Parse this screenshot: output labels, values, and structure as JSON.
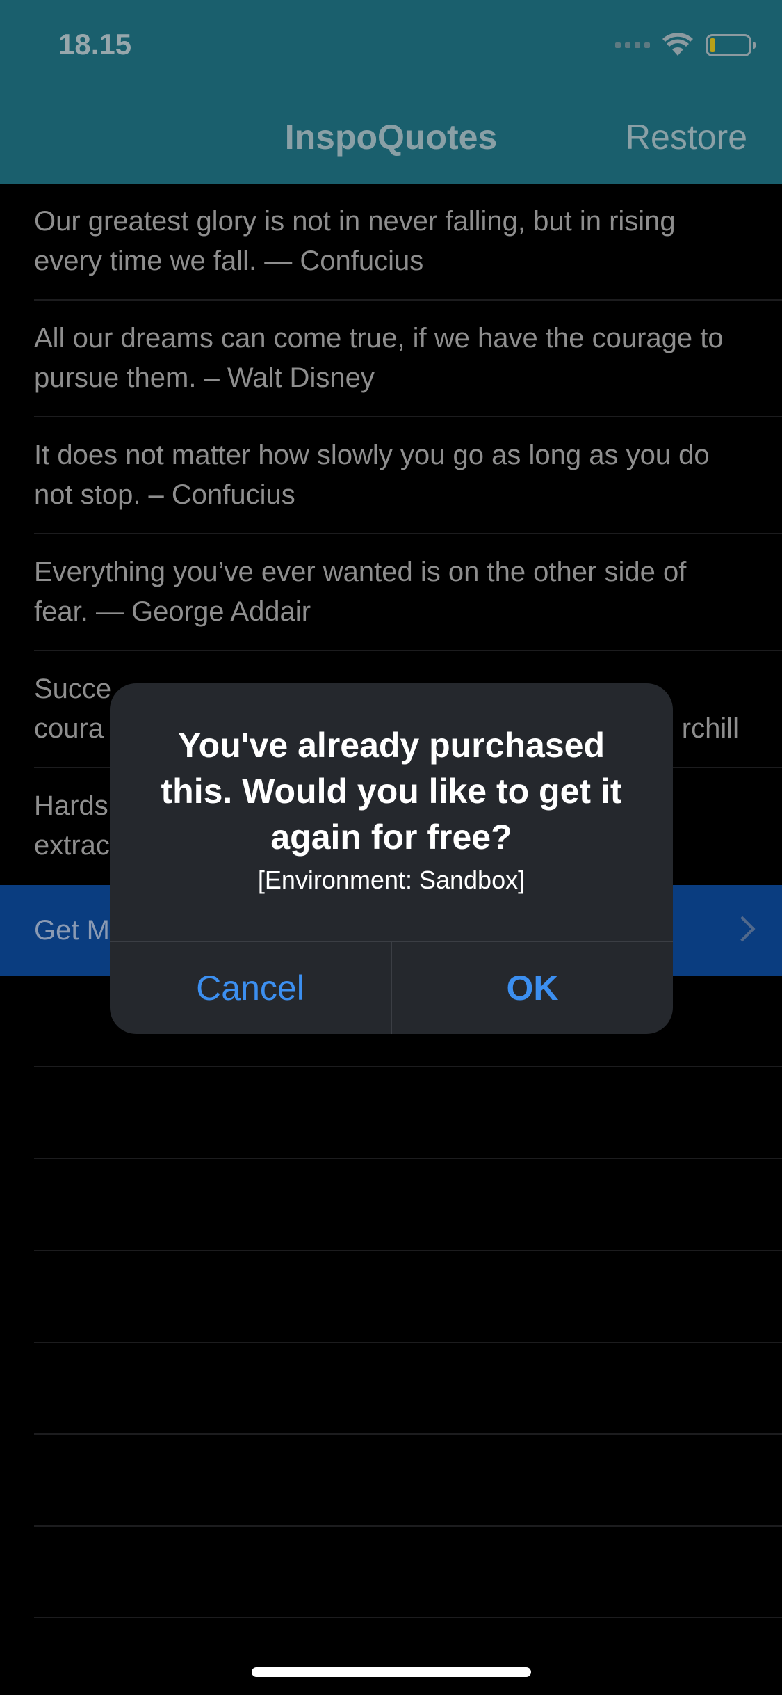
{
  "status_bar": {
    "time": "18.15",
    "battery_level": 0.15,
    "battery_color": "#b9a019"
  },
  "nav": {
    "title": "InspoQuotes",
    "restore_label": "Restore",
    "background": "#1a5f6d"
  },
  "quotes": [
    {
      "text": "Our greatest glory is not in never falling, but in rising every time we fall. — Confucius"
    },
    {
      "text": "All our dreams can come true, if we have the courage to pursue them. – Walt Disney"
    },
    {
      "text": "It does not matter how slowly you go as long as you do not stop. – Confucius"
    },
    {
      "text": "Everything you’ve ever wanted is on the other side of fear. — George Addair"
    },
    {
      "text": "Succe… coura… …rchill"
    },
    {
      "text": "Hards… extrac…"
    }
  ],
  "get_more": {
    "label": "Get M",
    "icon": "chevron-right-icon",
    "background": "#0a3d80"
  },
  "alert": {
    "title": "You've already purchased this. Would you like to get it again for free?",
    "message": "[Environment: Sandbox]",
    "cancel_label": "Cancel",
    "ok_label": "OK",
    "button_color": "#3c8ff0"
  }
}
